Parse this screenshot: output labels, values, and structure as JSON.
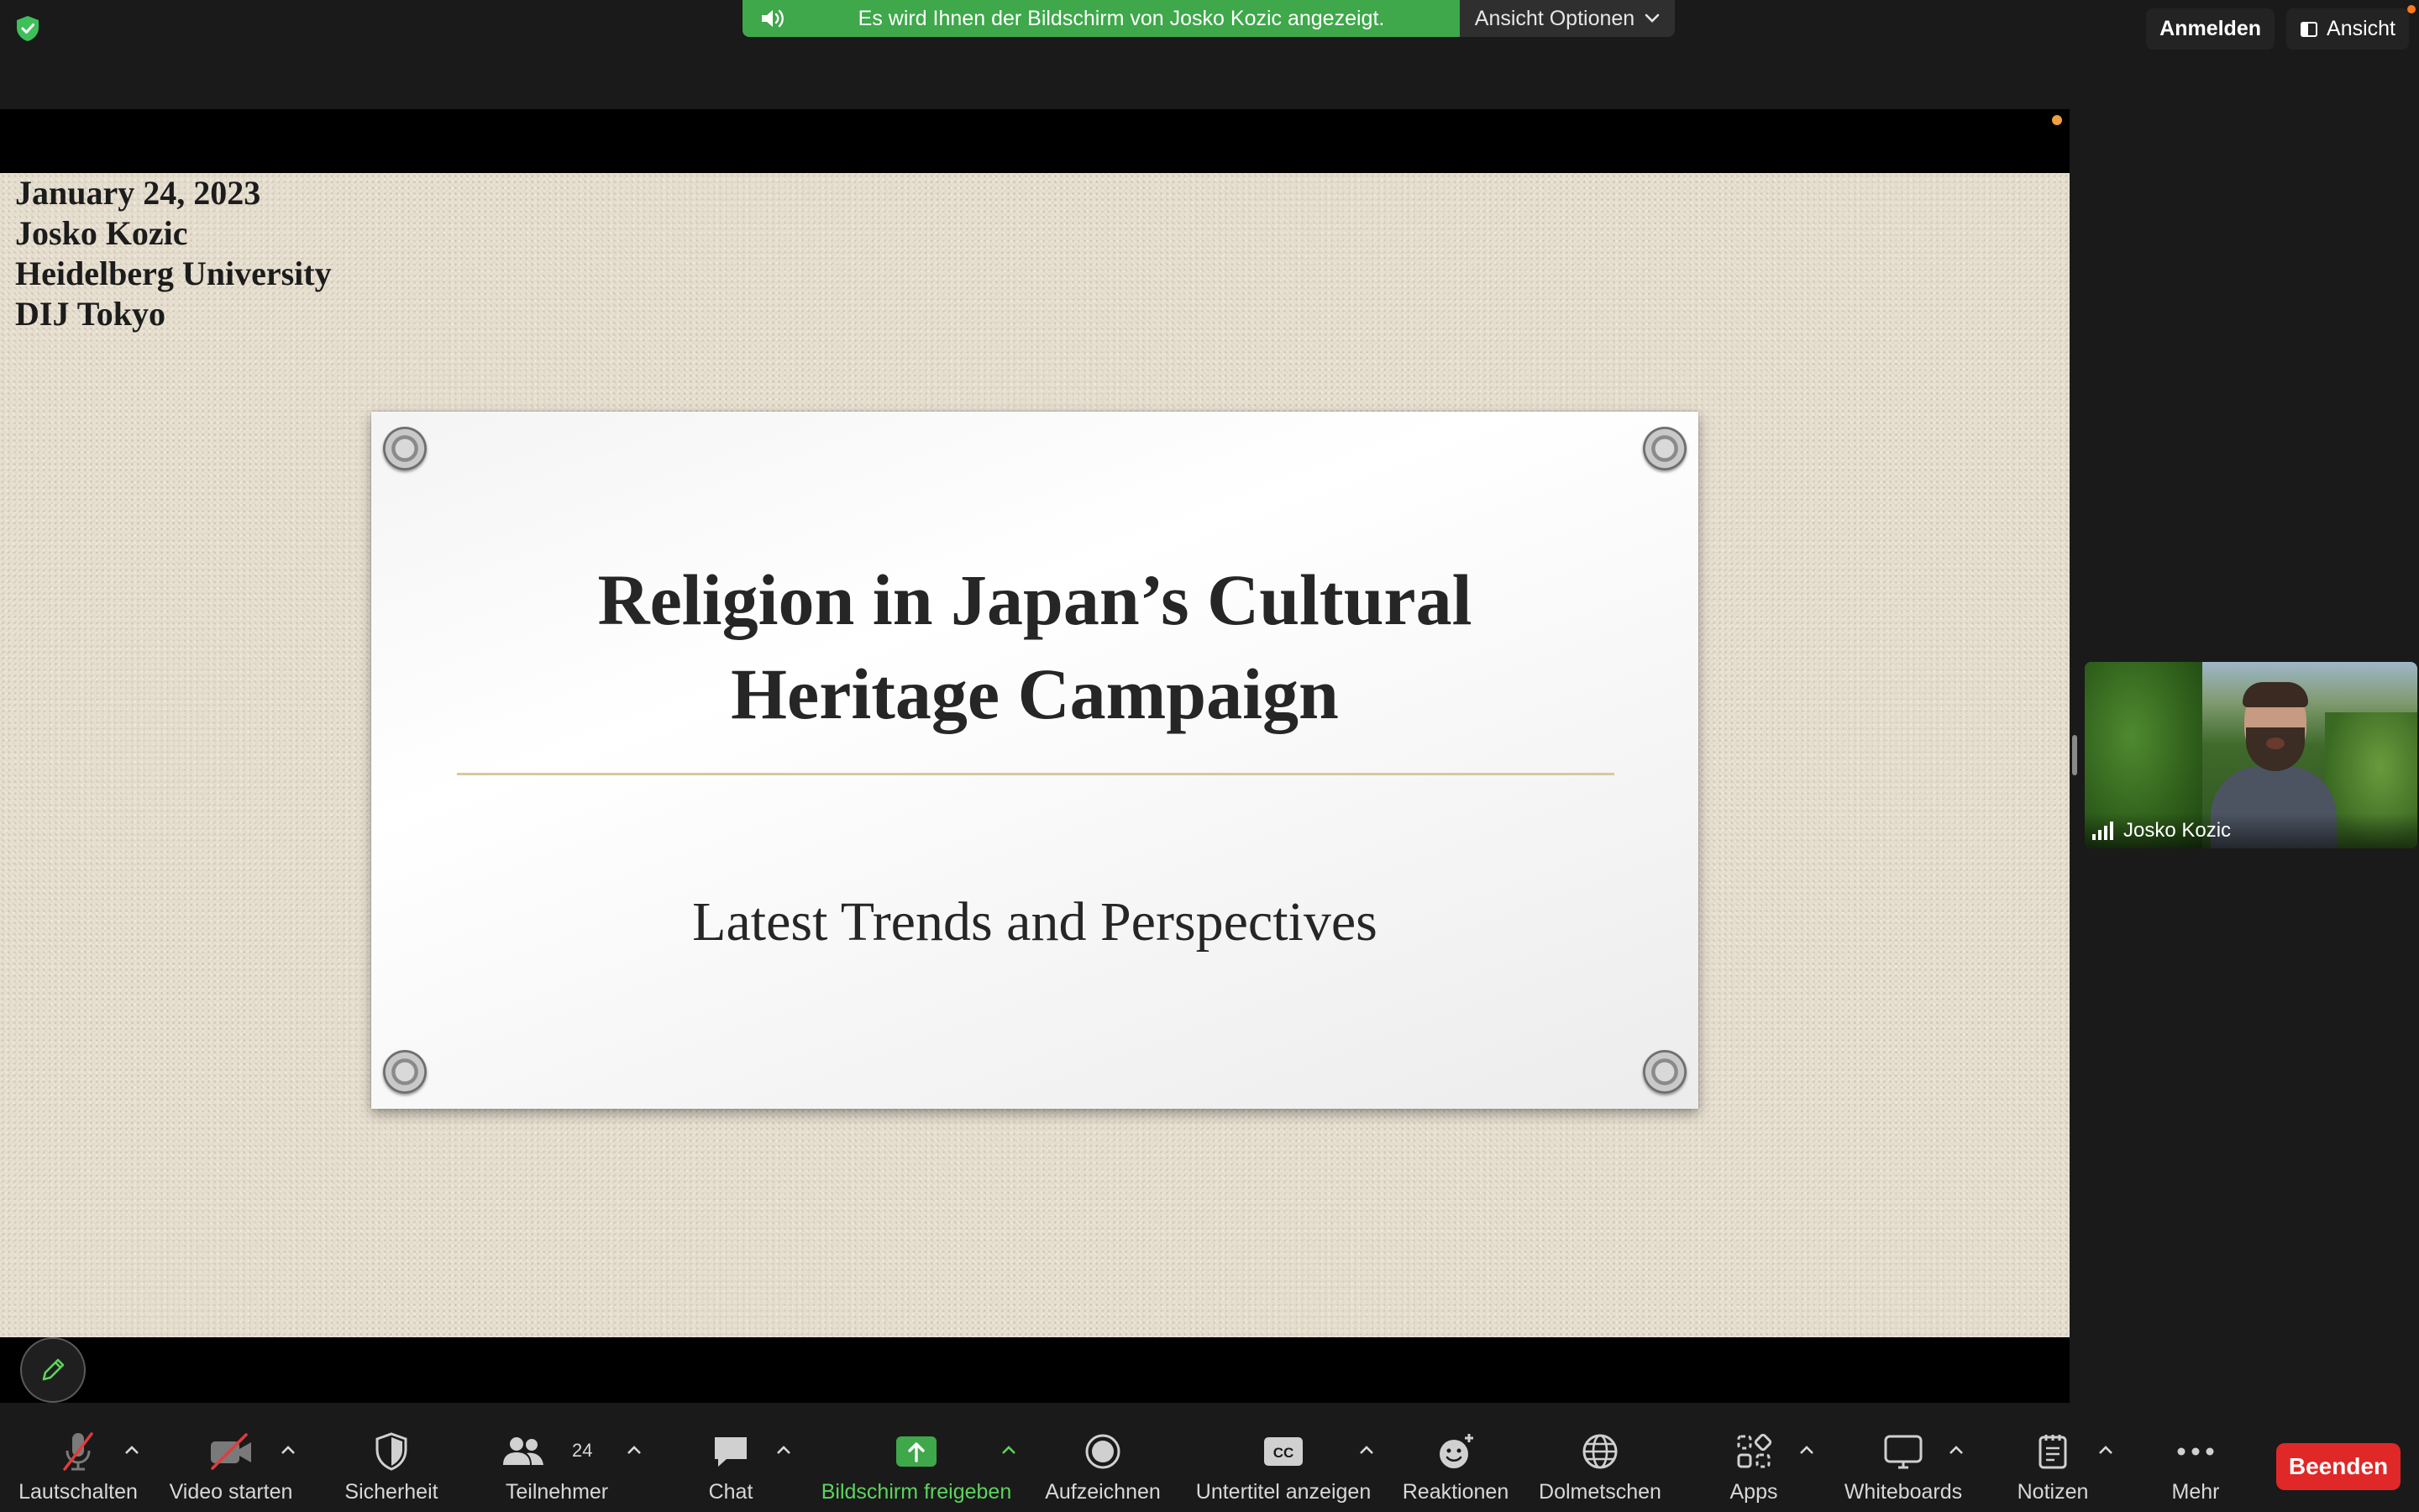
{
  "topbar": {
    "share_notice": "Es wird Ihnen der Bildschirm von Josko Kozic angezeigt.",
    "view_options": "Ansicht Optionen",
    "sign_in": "Anmelden",
    "view": "Ansicht"
  },
  "slide": {
    "meta_lines": [
      "January 24, 2023",
      "Josko Kozic",
      "Heidelberg University",
      "DIJ Tokyo"
    ],
    "title_line1": "Religion in Japan’s Cultural",
    "title_line2": "Heritage Campaign",
    "subtitle": "Latest Trends and Perspectives"
  },
  "video": {
    "participant_name": "Josko Kozic"
  },
  "toolbar": {
    "mute": "Lautschalten",
    "video": "Video starten",
    "security": "Sicherheit",
    "participants": "Teilnehmer",
    "participants_count": "24",
    "chat": "Chat",
    "share_screen": "Bildschirm freigeben",
    "record": "Aufzeichnen",
    "captions": "Untertitel anzeigen",
    "captions_icon_text": "CC",
    "reactions": "Reaktionen",
    "interpret": "Dolmetschen",
    "apps": "Apps",
    "whiteboards": "Whiteboards",
    "notes": "Notizen",
    "more": "Mehr",
    "end": "Beenden"
  },
  "colors": {
    "share_green": "#3ea84a",
    "share_label_green": "#5dd35d",
    "end_red": "#e02828",
    "background": "#1a1a1a"
  }
}
